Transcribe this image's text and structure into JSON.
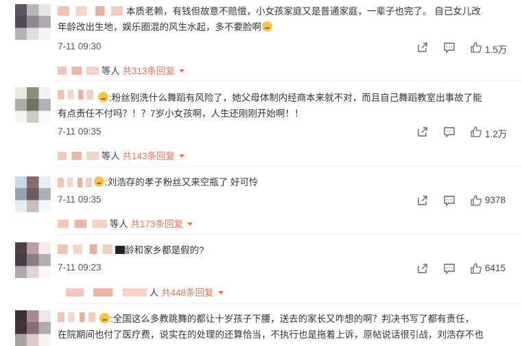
{
  "colors": {
    "accent": "#eb7350",
    "text": "#333333",
    "icon": "#666666"
  },
  "comments": [
    {
      "lines": [
        "本质老赖，有钱但故意不赔偿，小女孩家庭又是普通家庭，一辈子也完了。 自己女儿改",
        "年龄改出生地，娱乐圈混的风生水起，多不要脸啊"
      ],
      "time": "7-11 09:30",
      "likes": "1.5万",
      "replies_prefix": "等人",
      "replies_count": "共313条回复"
    },
    {
      "lines": [
        ":粉丝别洗什么舞蹈有风险了，她父母体制内经商本来就不对，而且自己舞蹈教室出事故了能",
        "有点责任不付吗？！？7岁小女孩啊，人生还刚刚开始啊！！"
      ],
      "time": "7-11 09:35",
      "likes": "1.2万",
      "replies_prefix": "等人",
      "replies_count": "共143条回复"
    },
    {
      "lines": [
        ":刘浩存的孝子粉丝又来空瓶了 好可怜"
      ],
      "time": "7-11 09:35",
      "likes": "9378",
      "replies_prefix": "等人",
      "replies_count": "共173条回复"
    },
    {
      "lines": [
        "龄和家乡都是假的?"
      ],
      "time": "7-11 09:23",
      "likes": "6415",
      "replies_prefix": "人",
      "replies_count": "共448条回复"
    },
    {
      "lines": [
        ":全国这么多教跳舞的都让十岁孩子下腰，送去的家长又咋想的啊？判决书写了都有责任，",
        "在院期间也付了医疗费，说实在的处理的还算恰当，不执行也是拖着上诉，原帖说话很引战，刘浩存不也"
      ],
      "time": "",
      "likes": "",
      "replies_prefix": "",
      "replies_count": ""
    }
  ],
  "icons": {
    "share": "share-icon",
    "comment": "comment-icon",
    "like": "thumbs-up-icon"
  }
}
